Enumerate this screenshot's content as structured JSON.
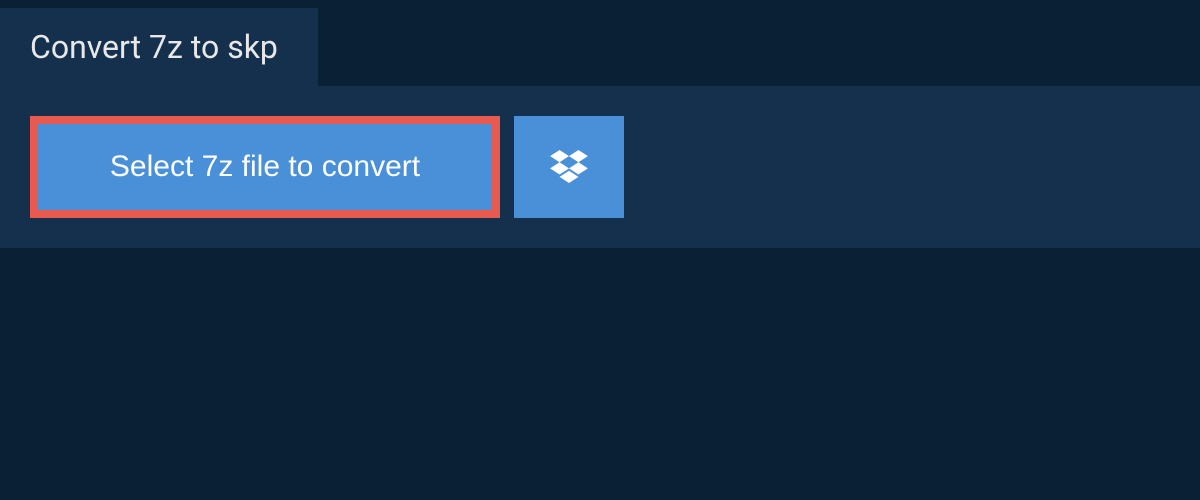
{
  "tab": {
    "title": "Convert 7z to skp"
  },
  "actions": {
    "select_file_label": "Select 7z file to convert"
  }
}
